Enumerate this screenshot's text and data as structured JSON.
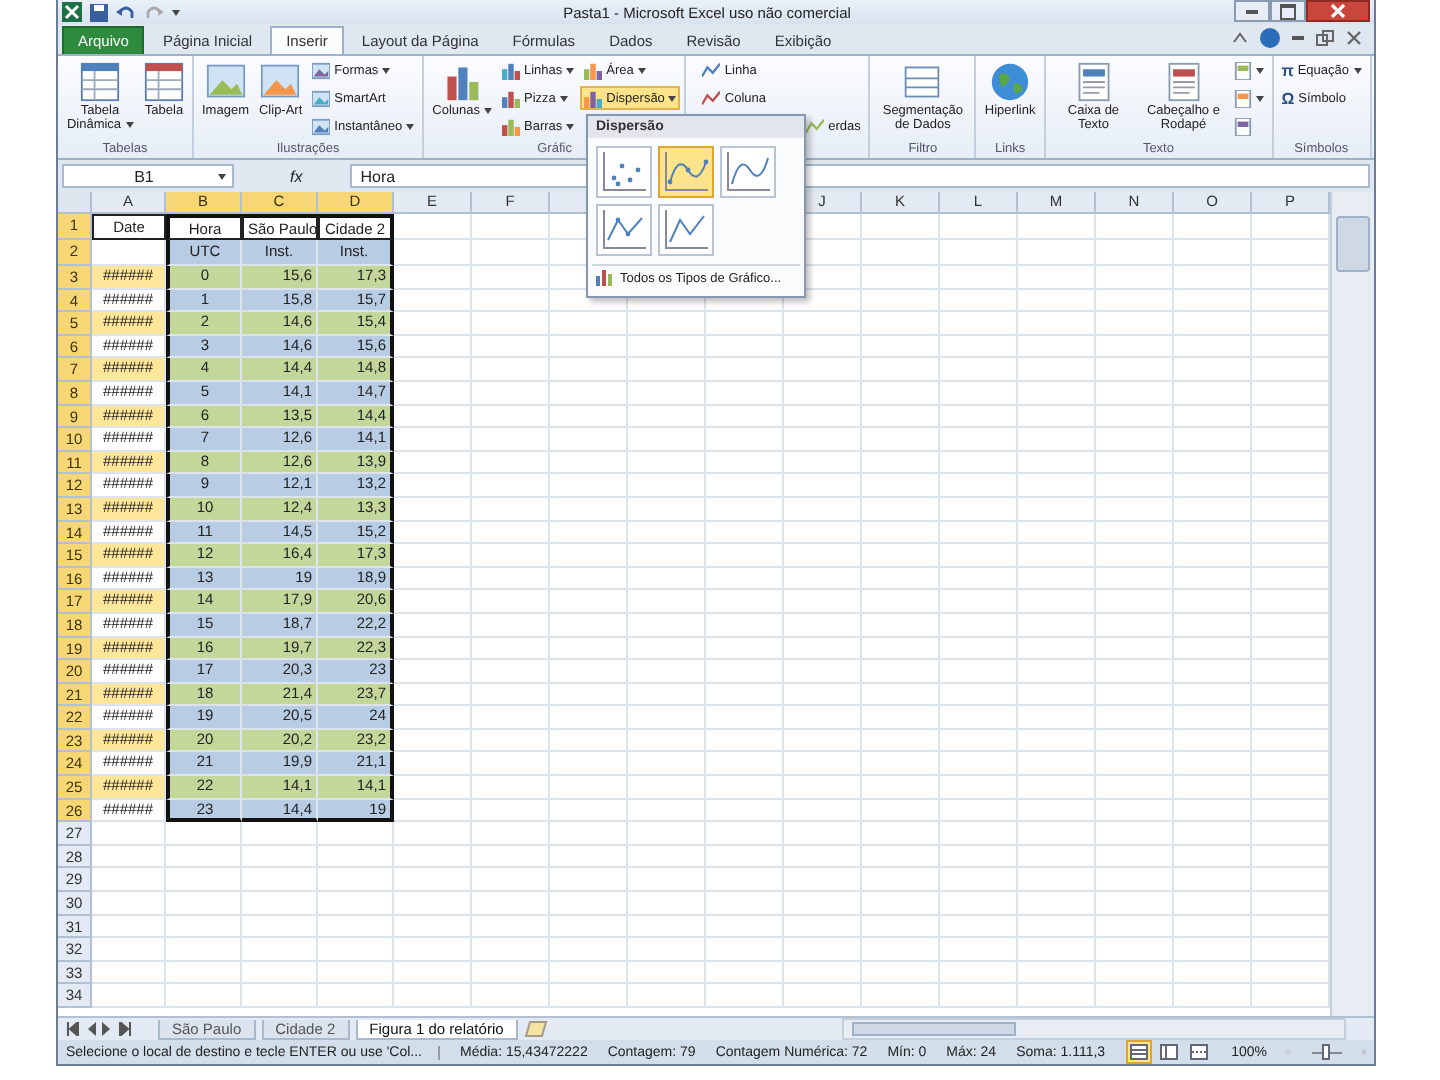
{
  "window": {
    "title": "Pasta1 - Microsoft Excel uso não comercial"
  },
  "ribbon_tabs": [
    {
      "label": "Arquivo",
      "kind": "file",
      "selected": false
    },
    {
      "label": "Página Inicial",
      "kind": "tab",
      "selected": false
    },
    {
      "label": "Inserir",
      "kind": "tab",
      "selected": true
    },
    {
      "label": "Layout da Página",
      "kind": "tab",
      "selected": false
    },
    {
      "label": "Fórmulas",
      "kind": "tab",
      "selected": false
    },
    {
      "label": "Dados",
      "kind": "tab",
      "selected": false
    },
    {
      "label": "Revisão",
      "kind": "tab",
      "selected": false
    },
    {
      "label": "Exibição",
      "kind": "tab",
      "selected": false
    }
  ],
  "ribbon_groups": [
    {
      "label": "Tabelas",
      "kind": "tables",
      "items": [
        {
          "kind": "large",
          "label": "Tabela Dinâmica",
          "caret": true
        },
        {
          "kind": "large",
          "label": "Tabela",
          "caret": false
        }
      ]
    },
    {
      "label": "Ilustrações",
      "kind": "illustrations",
      "items": [
        {
          "kind": "large",
          "label": "Imagem",
          "caret": false
        },
        {
          "kind": "large",
          "label": "Clip-Art",
          "caret": false
        },
        {
          "kind": "small",
          "label": "Formas",
          "caret": true
        },
        {
          "kind": "small",
          "label": "SmartArt",
          "caret": false
        },
        {
          "kind": "small",
          "label": "Instantâneo",
          "caret": true
        }
      ]
    },
    {
      "label": "Gráfic",
      "kind": "charts",
      "items": [
        {
          "kind": "large",
          "label": "Colunas",
          "caret": true,
          "pressed": false
        },
        {
          "kind": "small",
          "label": "Linhas",
          "caret": true,
          "pressed": false
        },
        {
          "kind": "small",
          "label": "Pizza",
          "caret": true,
          "pressed": false
        },
        {
          "kind": "small",
          "label": "Barras",
          "caret": true,
          "pressed": false
        },
        {
          "kind": "small",
          "label": "Área",
          "caret": true,
          "pressed": false
        },
        {
          "kind": "small",
          "label": "Dispersão",
          "caret": true,
          "pressed": true
        }
      ]
    },
    {
      "kind": "sparklines",
      "items": [
        {
          "kind": "small",
          "label": "Linha",
          "caret": false
        },
        {
          "kind": "small",
          "label": "Coluna",
          "caret": false
        },
        {
          "kind": "small",
          "label": "erdas",
          "caret": false
        }
      ]
    },
    {
      "label": "Filtro",
      "kind": "filter",
      "items": [
        {
          "kind": "large",
          "label": "Segmentação de Dados",
          "caret": false
        }
      ]
    },
    {
      "label": "Links",
      "kind": "links",
      "items": [
        {
          "kind": "large",
          "label": "Hiperlink",
          "caret": false
        }
      ]
    },
    {
      "label": "Texto",
      "kind": "text",
      "items": [
        {
          "kind": "large",
          "label": "Caixa de Texto",
          "caret": false
        },
        {
          "kind": "large",
          "label": "Cabeçalho e Rodapé",
          "caret": false
        },
        {
          "kind": "small",
          "caret": true
        },
        {
          "kind": "small",
          "caret": true
        },
        {
          "kind": "small",
          "caret": false
        }
      ]
    },
    {
      "label": "Símbolos",
      "kind": "symbols",
      "items": [
        {
          "kind": "small",
          "glyph": "π",
          "label": "Equação",
          "caret": true
        },
        {
          "kind": "small",
          "glyph": "Ω",
          "label": "Símbolo",
          "caret": false
        }
      ]
    }
  ],
  "gallery": {
    "header": "Dispersão",
    "options": [
      {
        "kind": "markers",
        "selected": false
      },
      {
        "kind": "smooth_markers",
        "selected": true
      },
      {
        "kind": "smooth_lines",
        "selected": false
      },
      {
        "kind": "straight_markers",
        "selected": false
      },
      {
        "kind": "straight_lines",
        "selected": false
      }
    ],
    "footer": "Todos os Tipos de Gráfico..."
  },
  "formula_bar": {
    "name_box": "B1",
    "fx": "fx",
    "value": "Hora"
  },
  "sheet": {
    "columns": [
      {
        "label": "A",
        "selected": false
      },
      {
        "label": "B",
        "selected": true
      },
      {
        "label": "C",
        "selected": true
      },
      {
        "label": "D",
        "selected": true
      },
      {
        "label": "E",
        "selected": false
      },
      {
        "label": "F",
        "selected": false
      },
      {
        "label": "J",
        "selected": false
      },
      {
        "label": "K",
        "selected": false
      },
      {
        "label": "L",
        "selected": false
      },
      {
        "label": "M",
        "selected": false
      },
      {
        "label": "N",
        "selected": false
      },
      {
        "label": "O",
        "selected": false
      },
      {
        "label": "P",
        "selected": false
      }
    ],
    "rows": [
      {
        "label": "1",
        "selected": true,
        "kind": "header",
        "cells": [
          {
            "text": "Date",
            "color": "#ffffff"
          },
          {
            "text": "Hora",
            "color": "#ffffff"
          },
          {
            "text": "São Paulo",
            "color": "#ffffff"
          },
          {
            "text": "Cidade 2",
            "color": "#ffffff"
          }
        ]
      },
      {
        "label": "2",
        "selected": true,
        "kind": "header",
        "cells": [
          {
            "color": "#ffffff"
          },
          {
            "text": "UTC",
            "color": "#b8cce4"
          },
          {
            "text": "Inst.",
            "color": "#b8cce4"
          },
          {
            "text": "Inst.",
            "color": "#b8cce4"
          }
        ]
      },
      {
        "label": "3",
        "selected": true,
        "kind": "data",
        "cells": [
          {
            "text": "######",
            "color": "#ffe699"
          },
          {
            "text": "0",
            "color": "#c4d79b"
          },
          {
            "text": "15,6",
            "color": "#c4d79b"
          },
          {
            "text": "17,3",
            "color": "#c4d79b"
          }
        ]
      },
      {
        "label": "4",
        "selected": true,
        "kind": "data",
        "cells": [
          {
            "text": "######",
            "color": "#ffffff"
          },
          {
            "text": "1",
            "color": "#b8cce4"
          },
          {
            "text": "15,8",
            "color": "#b8cce4"
          },
          {
            "text": "15,7",
            "color": "#b8cce4"
          }
        ]
      },
      {
        "label": "5",
        "selected": true,
        "kind": "data",
        "cells": [
          {
            "text": "######",
            "color": "#ffe699"
          },
          {
            "text": "2",
            "color": "#c4d79b"
          },
          {
            "text": "14,6",
            "color": "#c4d79b"
          },
          {
            "text": "15,4",
            "color": "#c4d79b"
          }
        ]
      },
      {
        "label": "6",
        "selected": true,
        "kind": "data",
        "cells": [
          {
            "text": "######",
            "color": "#ffffff"
          },
          {
            "text": "3",
            "color": "#b8cce4"
          },
          {
            "text": "14,6",
            "color": "#b8cce4"
          },
          {
            "text": "15,6",
            "color": "#b8cce4"
          }
        ]
      },
      {
        "label": "7",
        "selected": true,
        "kind": "data",
        "cells": [
          {
            "text": "######",
            "color": "#ffe699"
          },
          {
            "text": "4",
            "color": "#c4d79b"
          },
          {
            "text": "14,4",
            "color": "#c4d79b"
          },
          {
            "text": "14,8",
            "color": "#c4d79b"
          }
        ]
      },
      {
        "label": "8",
        "selected": true,
        "kind": "data",
        "cells": [
          {
            "text": "######",
            "color": "#ffffff"
          },
          {
            "text": "5",
            "color": "#b8cce4"
          },
          {
            "text": "14,1",
            "color": "#b8cce4"
          },
          {
            "text": "14,7",
            "color": "#b8cce4"
          }
        ]
      },
      {
        "label": "9",
        "selected": true,
        "kind": "data",
        "cells": [
          {
            "text": "######",
            "color": "#ffe699"
          },
          {
            "text": "6",
            "color": "#c4d79b"
          },
          {
            "text": "13,5",
            "color": "#c4d79b"
          },
          {
            "text": "14,4",
            "color": "#c4d79b"
          }
        ]
      },
      {
        "label": "10",
        "selected": true,
        "kind": "data",
        "cells": [
          {
            "text": "######",
            "color": "#ffffff"
          },
          {
            "text": "7",
            "color": "#b8cce4"
          },
          {
            "text": "12,6",
            "color": "#b8cce4"
          },
          {
            "text": "14,1",
            "color": "#b8cce4"
          }
        ]
      },
      {
        "label": "11",
        "selected": true,
        "kind": "data",
        "cells": [
          {
            "text": "######",
            "color": "#ffe699"
          },
          {
            "text": "8",
            "color": "#c4d79b"
          },
          {
            "text": "12,6",
            "color": "#c4d79b"
          },
          {
            "text": "13,9",
            "color": "#c4d79b"
          }
        ]
      },
      {
        "label": "12",
        "selected": true,
        "kind": "data",
        "cells": [
          {
            "text": "######",
            "color": "#ffffff"
          },
          {
            "text": "9",
            "color": "#b8cce4"
          },
          {
            "text": "12,1",
            "color": "#b8cce4"
          },
          {
            "text": "13,2",
            "color": "#b8cce4"
          }
        ]
      },
      {
        "label": "13",
        "selected": true,
        "kind": "data",
        "cells": [
          {
            "text": "######",
            "color": "#ffe699"
          },
          {
            "text": "10",
            "color": "#c4d79b"
          },
          {
            "text": "12,4",
            "color": "#c4d79b"
          },
          {
            "text": "13,3",
            "color": "#c4d79b"
          }
        ]
      },
      {
        "label": "14",
        "selected": true,
        "kind": "data",
        "cells": [
          {
            "text": "######",
            "color": "#ffffff"
          },
          {
            "text": "11",
            "color": "#b8cce4"
          },
          {
            "text": "14,5",
            "color": "#b8cce4"
          },
          {
            "text": "15,2",
            "color": "#b8cce4"
          }
        ]
      },
      {
        "label": "15",
        "selected": true,
        "kind": "data",
        "cells": [
          {
            "text": "######",
            "color": "#ffe699"
          },
          {
            "text": "12",
            "color": "#c4d79b"
          },
          {
            "text": "16,4",
            "color": "#c4d79b"
          },
          {
            "text": "17,3",
            "color": "#c4d79b"
          }
        ]
      },
      {
        "label": "16",
        "selected": true,
        "kind": "data",
        "cells": [
          {
            "text": "######",
            "color": "#ffffff"
          },
          {
            "text": "13",
            "color": "#b8cce4"
          },
          {
            "text": "19",
            "color": "#b8cce4"
          },
          {
            "text": "18,9",
            "color": "#b8cce4"
          }
        ]
      },
      {
        "label": "17",
        "selected": true,
        "kind": "data",
        "cells": [
          {
            "text": "######",
            "color": "#ffe699"
          },
          {
            "text": "14",
            "color": "#c4d79b"
          },
          {
            "text": "17,9",
            "color": "#c4d79b"
          },
          {
            "text": "20,6",
            "color": "#c4d79b"
          }
        ]
      },
      {
        "label": "18",
        "selected": true,
        "kind": "data",
        "cells": [
          {
            "text": "######",
            "color": "#ffffff"
          },
          {
            "text": "15",
            "color": "#b8cce4"
          },
          {
            "text": "18,7",
            "color": "#b8cce4"
          },
          {
            "text": "22,2",
            "color": "#b8cce4"
          }
        ]
      },
      {
        "label": "19",
        "selected": true,
        "kind": "data",
        "cells": [
          {
            "text": "######",
            "color": "#ffe699"
          },
          {
            "text": "16",
            "color": "#c4d79b"
          },
          {
            "text": "19,7",
            "color": "#c4d79b"
          },
          {
            "text": "22,3",
            "color": "#c4d79b"
          }
        ]
      },
      {
        "label": "20",
        "selected": true,
        "kind": "data",
        "cells": [
          {
            "text": "######",
            "color": "#ffffff"
          },
          {
            "text": "17",
            "color": "#b8cce4"
          },
          {
            "text": "20,3",
            "color": "#b8cce4"
          },
          {
            "text": "23",
            "color": "#b8cce4"
          }
        ]
      },
      {
        "label": "21",
        "selected": true,
        "kind": "data",
        "cells": [
          {
            "text": "######",
            "color": "#ffe699"
          },
          {
            "text": "18",
            "color": "#c4d79b"
          },
          {
            "text": "21,4",
            "color": "#c4d79b"
          },
          {
            "text": "23,7",
            "color": "#c4d79b"
          }
        ]
      },
      {
        "label": "22",
        "selected": true,
        "kind": "data",
        "cells": [
          {
            "text": "######",
            "color": "#ffffff"
          },
          {
            "text": "19",
            "color": "#b8cce4"
          },
          {
            "text": "20,5",
            "color": "#b8cce4"
          },
          {
            "text": "24",
            "color": "#b8cce4"
          }
        ]
      },
      {
        "label": "23",
        "selected": true,
        "kind": "data",
        "cells": [
          {
            "text": "######",
            "color": "#ffe699"
          },
          {
            "text": "20",
            "color": "#c4d79b"
          },
          {
            "text": "20,2",
            "color": "#c4d79b"
          },
          {
            "text": "23,2",
            "color": "#c4d79b"
          }
        ]
      },
      {
        "label": "24",
        "selected": true,
        "kind": "data",
        "cells": [
          {
            "text": "######",
            "color": "#ffffff"
          },
          {
            "text": "21",
            "color": "#b8cce4"
          },
          {
            "text": "19,9",
            "color": "#b8cce4"
          },
          {
            "text": "21,1",
            "color": "#b8cce4"
          }
        ]
      },
      {
        "label": "25",
        "selected": true,
        "kind": "data",
        "cells": [
          {
            "text": "######",
            "color": "#ffe699"
          },
          {
            "text": "22",
            "color": "#c4d79b"
          },
          {
            "text": "14,1",
            "color": "#c4d79b"
          },
          {
            "text": "14,1",
            "color": "#c4d79b"
          }
        ]
      },
      {
        "label": "26",
        "selected": true,
        "kind": "data",
        "cells": [
          {
            "text": "######",
            "color": "#ffffff"
          },
          {
            "text": "23",
            "color": "#b8cce4"
          },
          {
            "text": "14,4",
            "color": "#b8cce4"
          },
          {
            "text": "19",
            "color": "#b8cce4"
          }
        ]
      },
      {
        "label": "27",
        "selected": false,
        "kind": "empty"
      },
      {
        "label": "28",
        "selected": false,
        "kind": "empty"
      },
      {
        "label": "29",
        "selected": false,
        "kind": "empty"
      },
      {
        "label": "30",
        "selected": false,
        "kind": "empty"
      },
      {
        "label": "31",
        "selected": false,
        "kind": "empty"
      },
      {
        "label": "32",
        "selected": false,
        "kind": "empty"
      },
      {
        "label": "33",
        "selected": false,
        "kind": "empty"
      },
      {
        "label": "34",
        "selected": false,
        "kind": "empty"
      }
    ]
  },
  "sheet_tabs": [
    {
      "label": "São Paulo",
      "selected": false
    },
    {
      "label": "Cidade 2",
      "selected": false
    },
    {
      "label": "Figura 1 do relatório",
      "selected": true
    }
  ],
  "status_bar": {
    "message": "Selecione o local de destino e tecle ENTER ou use 'Col...",
    "stats": [
      "Média: 15,43472222",
      "Contagem: 79",
      "Contagem Numérica: 72",
      "Mín: 0",
      "Máx: 24",
      "Soma: 1.111,3"
    ],
    "views": [
      {
        "kind": "normal",
        "selected": true
      },
      {
        "kind": "layout",
        "selected": false
      },
      {
        "kind": "pagebreak",
        "selected": false
      }
    ],
    "zoom": "100%",
    "zoom_slider": {
      "level": 0.5
    }
  }
}
